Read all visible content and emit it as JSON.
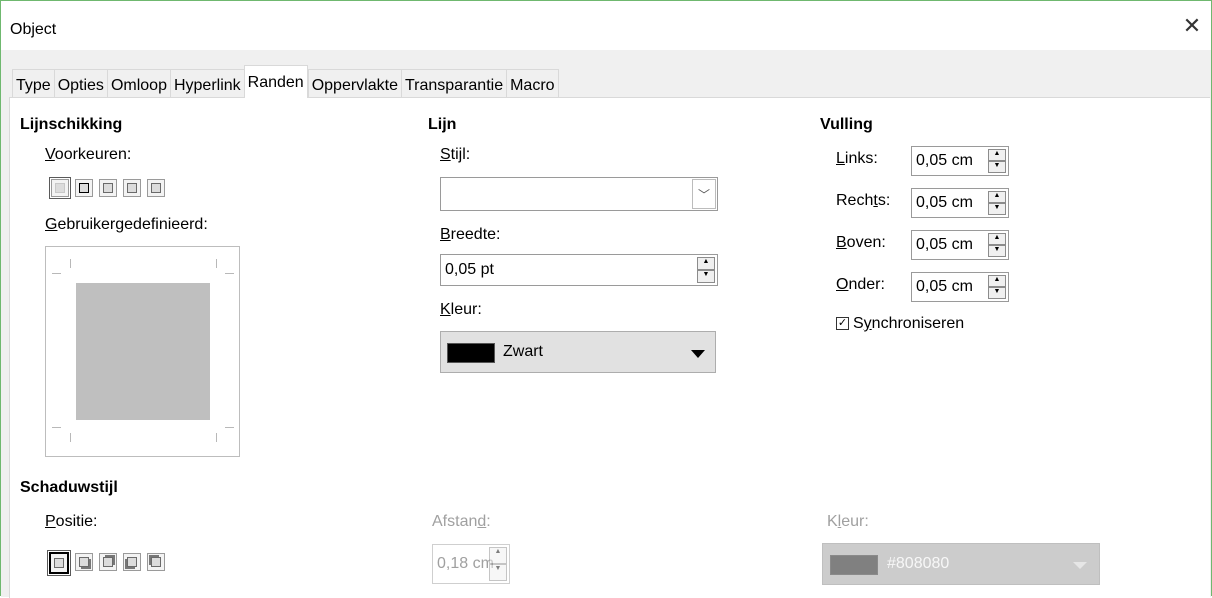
{
  "window": {
    "title": "Object"
  },
  "tabs": [
    {
      "label": "Type"
    },
    {
      "label": "Opties"
    },
    {
      "label": "Omloop"
    },
    {
      "label": "Hyperlink"
    },
    {
      "label": "Randen",
      "active": true
    },
    {
      "label": "Oppervlakte"
    },
    {
      "label": "Transparantie"
    },
    {
      "label": "Macro"
    }
  ],
  "lijnschikking": {
    "heading": "Lijnschikking",
    "presets_label_u": "V",
    "presets_label_rest": "oorkeuren:",
    "custom_label_u": "G",
    "custom_label_rest": "ebruikergedefinieerd:"
  },
  "lijn": {
    "heading": "Lijn",
    "style_label_u": "S",
    "style_label_rest": "tijl:",
    "style_value": "",
    "width_label_u": "B",
    "width_label_rest": "reedte:",
    "width_value": "0,05 pt",
    "color_label_u": "K",
    "color_label_rest": "leur:",
    "color_name": "Zwart",
    "color_hex": "#000000"
  },
  "vulling": {
    "heading": "Vulling",
    "left_label_u": "L",
    "left_label_rest": "inks:",
    "left_value": "0,05 cm",
    "right_label_a": "Rech",
    "right_label_u": "t",
    "right_label_b": "s:",
    "right_value": "0,05 cm",
    "top_label_u": "B",
    "top_label_rest": "oven:",
    "top_value": "0,05 cm",
    "bottom_label_u": "O",
    "bottom_label_rest": "nder:",
    "bottom_value": "0,05 cm",
    "sync_a": "S",
    "sync_u": "y",
    "sync_b": "nchroniseren",
    "sync_checked": true
  },
  "schaduw": {
    "heading": "Schaduwstijl",
    "position_label_u": "P",
    "position_label_rest": "ositie:",
    "distance_label_a": "Afstan",
    "distance_label_u": "d",
    "distance_label_b": ":",
    "distance_value": "0,18 cm",
    "color_label_a": "K",
    "color_label_u": "l",
    "color_label_b": "eur:",
    "color_name": "#808080",
    "color_hex": "#808080"
  }
}
